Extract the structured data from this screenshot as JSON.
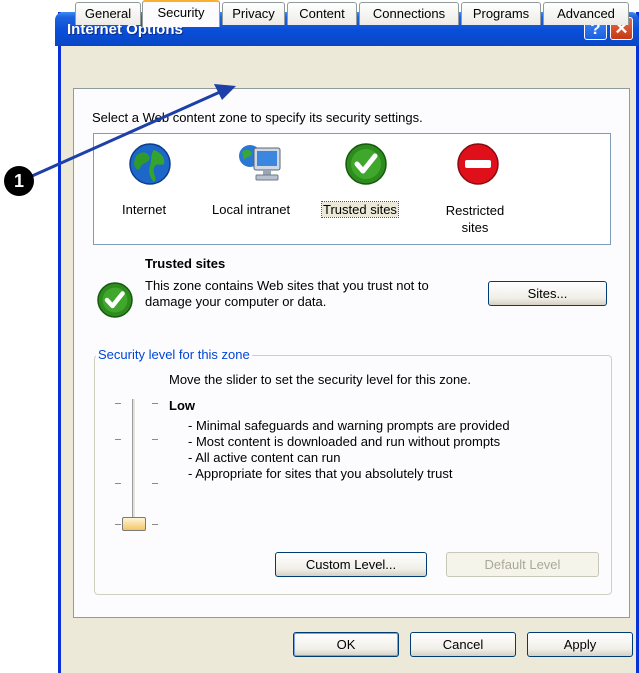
{
  "window": {
    "title": "Internet Options",
    "help_glyph": "?",
    "close_glyph": "✕"
  },
  "tabs": [
    {
      "label": "General"
    },
    {
      "label": "Security"
    },
    {
      "label": "Privacy"
    },
    {
      "label": "Content"
    },
    {
      "label": "Connections"
    },
    {
      "label": "Programs"
    },
    {
      "label": "Advanced"
    }
  ],
  "active_tab": "Security",
  "security": {
    "intro": "Select a Web content zone to specify its security settings.",
    "zones": [
      {
        "label": "Internet",
        "icon": "globe-icon"
      },
      {
        "label": "Local intranet",
        "icon": "computer-network-icon"
      },
      {
        "label": "Trusted sites",
        "icon": "check-circle-icon"
      },
      {
        "label": "Restricted sites",
        "icon": "no-entry-icon"
      }
    ],
    "selected_zone": "Trusted sites",
    "zone_heading": "Trusted sites",
    "zone_description": "This zone contains Web sites that you trust not to damage your computer or data.",
    "sites_button": "Sites...",
    "level_group_label": "Security level for this zone",
    "slider_instruction": "Move the slider to set the security level for this zone.",
    "level_name": "Low",
    "level_bullets": [
      "- Minimal safeguards and warning prompts are provided",
      "- Most content is downloaded and run without prompts",
      "- All active content can run",
      "- Appropriate for sites that you absolutely trust"
    ],
    "custom_level_button": "Custom Level...",
    "default_level_button": "Default Level"
  },
  "buttons": {
    "ok": "OK",
    "cancel": "Cancel",
    "apply": "Apply"
  },
  "annotation": {
    "number": "1"
  },
  "colors": {
    "title_blue": "#0a4ed8",
    "panel_bg": "#ece9d8",
    "link_blue": "#0046d5",
    "trusted_green": "#2e8b1e",
    "restricted_red": "#e0101b"
  }
}
